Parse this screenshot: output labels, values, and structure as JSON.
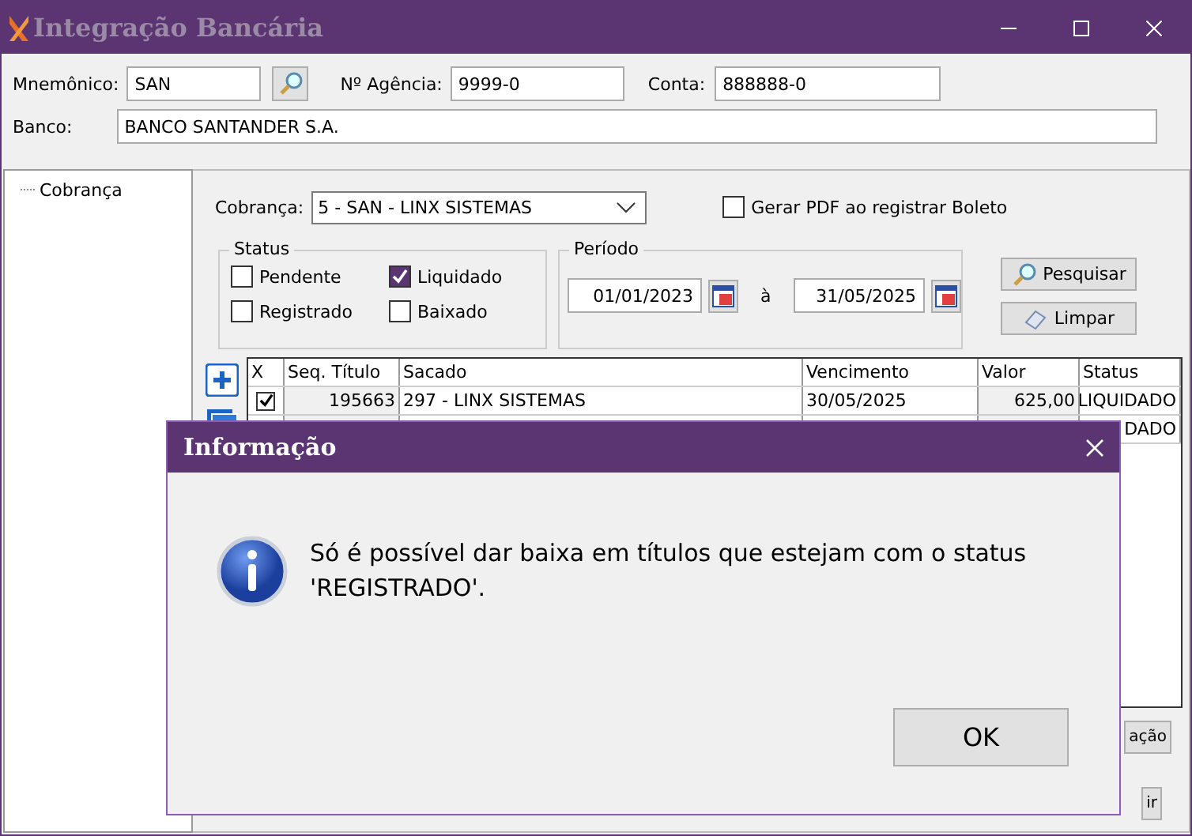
{
  "window": {
    "title": "Integração Bancária"
  },
  "header": {
    "mnemonico": {
      "label": "Mnemônico:",
      "value": "SAN"
    },
    "agencia": {
      "label": "Nº Agência:",
      "value": "9999-0"
    },
    "conta": {
      "label": "Conta:",
      "value": "888888-0"
    },
    "banco": {
      "label": "Banco:",
      "value": "BANCO SANTANDER S.A."
    }
  },
  "tree": [
    {
      "label": "Cobrança",
      "selected": false
    }
  ],
  "filters": {
    "cobranca": {
      "label": "Cobrança:",
      "value": "5 - SAN - LINX SISTEMAS"
    },
    "gerar_pdf": {
      "label": "Gerar PDF ao registrar Boleto",
      "checked": false
    },
    "status": {
      "title": "Status",
      "options": [
        {
          "label": "Pendente",
          "checked": false
        },
        {
          "label": "Liquidado",
          "checked": true
        },
        {
          "label": "Registrado",
          "checked": false
        },
        {
          "label": "Baixado",
          "checked": false
        }
      ]
    },
    "periodo": {
      "title": "Período",
      "from": "01/01/2023",
      "separator": "à",
      "to": "31/05/2025"
    },
    "buttons": [
      "Pesquisar",
      "Limpar"
    ]
  },
  "table": {
    "columns": [
      "X",
      "Seq. Título",
      "Sacado",
      "Vencimento",
      "Valor",
      "Status"
    ],
    "rows": [
      {
        "checked": true,
        "seq": "195663",
        "sacado": "297 - LINX SISTEMAS",
        "vencimento": "30/05/2025",
        "valor": "625,00",
        "status": "LIQUIDADO"
      },
      {
        "status": "DADO"
      }
    ]
  },
  "footer_buttons": [
    "ação",
    "ir"
  ],
  "dialog": {
    "title": "Informação",
    "message": "Só é possível dar baixa em títulos que estejam com o status 'REGISTRADO'.",
    "button": "OK"
  }
}
